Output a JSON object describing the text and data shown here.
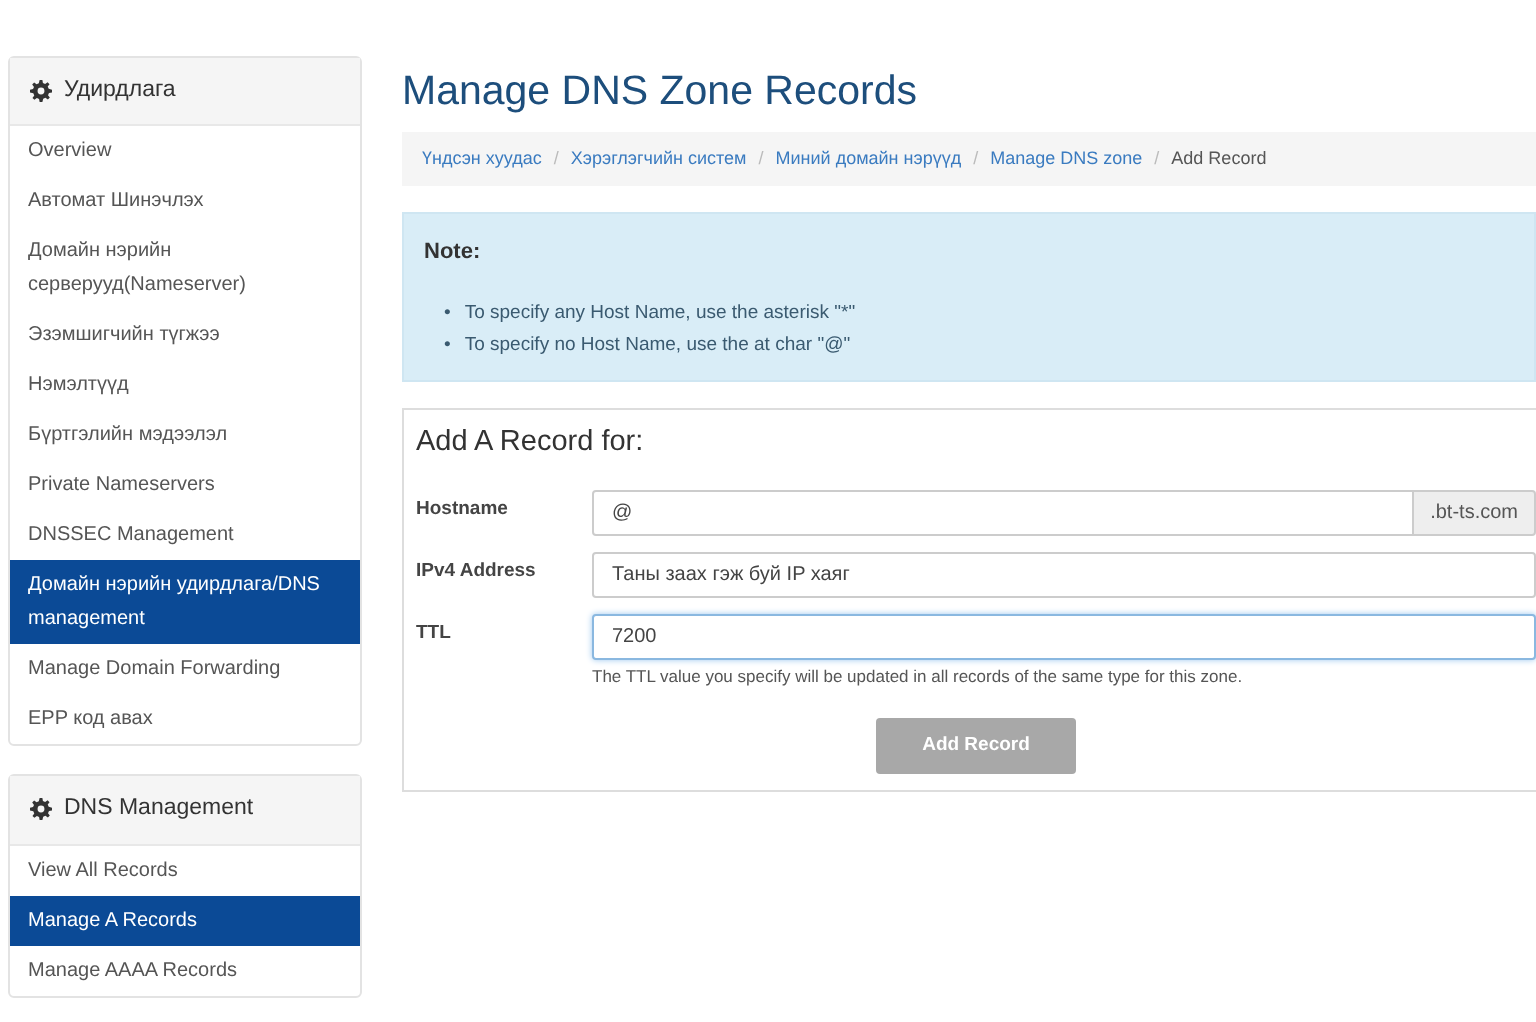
{
  "sidebar": [
    {
      "title": "Удирдлага",
      "items": [
        {
          "label": "Overview",
          "selected": false
        },
        {
          "label": "Автомат Шинэчлэх",
          "selected": false
        },
        {
          "label": "Домайн нэрийн серверууд(Nameserver)",
          "selected": false
        },
        {
          "label": "Эзэмшигчийн түгжээ",
          "selected": false
        },
        {
          "label": "Нэмэлтүүд",
          "selected": false
        },
        {
          "label": "Бүртгэлийн мэдээлэл",
          "selected": false
        },
        {
          "label": "Private Nameservers",
          "selected": false
        },
        {
          "label": "DNSSEC Management",
          "selected": false
        },
        {
          "label": "Домайн нэрийн удирдлага/DNS management",
          "selected": true
        },
        {
          "label": "Manage Domain Forwarding",
          "selected": false
        },
        {
          "label": "EPP код авах",
          "selected": false
        }
      ]
    },
    {
      "title": "DNS Management",
      "items": [
        {
          "label": "View All Records",
          "selected": false
        },
        {
          "label": "Manage A Records",
          "selected": true
        },
        {
          "label": "Manage AAAA Records",
          "selected": false
        }
      ]
    }
  ],
  "page_title": "Manage DNS Zone Records",
  "breadcrumb_separator": "/",
  "breadcrumb": [
    {
      "label": "Үндсэн хуудас",
      "current": false
    },
    {
      "label": "Хэрэглэгчийн систем",
      "current": false
    },
    {
      "label": "Миний домайн нэрүүд",
      "current": false
    },
    {
      "label": "Manage DNS zone",
      "current": false
    },
    {
      "label": "Add Record",
      "current": true
    }
  ],
  "note": {
    "title": "Note:",
    "bullet": "•",
    "items": [
      "To specify any Host Name, use the asterisk \"*\"",
      "To specify no Host Name, use the at char \"@\""
    ]
  },
  "form": {
    "title": "Add A Record for:",
    "fields": [
      {
        "label": "Hostname",
        "value": "@",
        "suffix": ".bt-ts.com",
        "focused": false
      },
      {
        "label": "IPv4 Address",
        "value": "Таны заах гэж буй IP хаяг",
        "focused": false
      },
      {
        "label": "TTL",
        "value": "7200",
        "focused": true,
        "help": "The TTL value you specify will be updated in all records of the same type for this zone."
      }
    ],
    "button": {
      "label": "Add Record",
      "disabled": true
    }
  }
}
